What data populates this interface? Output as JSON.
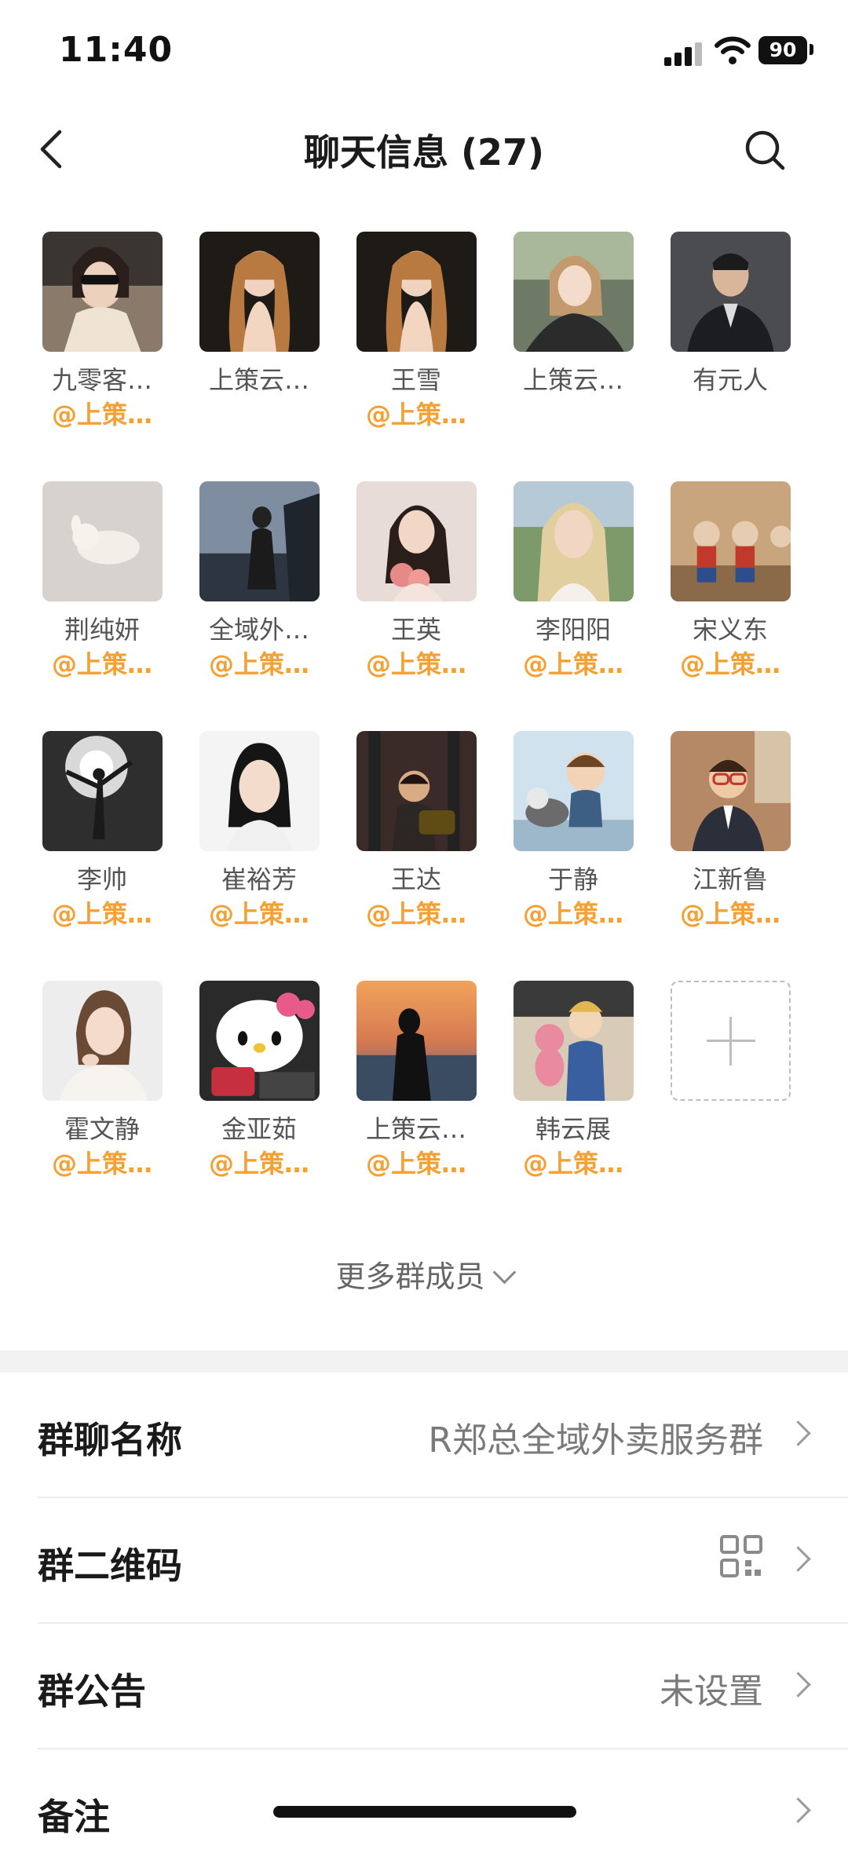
{
  "status_bar": {
    "time": "11:40",
    "battery": "90"
  },
  "header": {
    "title": "聊天信息 (27)"
  },
  "members": [
    {
      "name": "九零客…",
      "tag": "@上策…"
    },
    {
      "name": "上策云…",
      "tag": ""
    },
    {
      "name": "王雪",
      "tag": "@上策…"
    },
    {
      "name": "上策云…",
      "tag": ""
    },
    {
      "name": "有元人",
      "tag": ""
    },
    {
      "name": "荆纯妍",
      "tag": "@上策…"
    },
    {
      "name": "全域外…",
      "tag": "@上策…"
    },
    {
      "name": "王英",
      "tag": "@上策…"
    },
    {
      "name": "李阳阳",
      "tag": "@上策…"
    },
    {
      "name": "宋义东",
      "tag": "@上策…"
    },
    {
      "name": "李帅",
      "tag": "@上策…"
    },
    {
      "name": "崔裕芳",
      "tag": "@上策…"
    },
    {
      "name": "王达",
      "tag": "@上策…"
    },
    {
      "name": "于静",
      "tag": "@上策…"
    },
    {
      "name": "江新鲁",
      "tag": "@上策…"
    },
    {
      "name": "霍文静",
      "tag": "@上策…"
    },
    {
      "name": "金亚茹",
      "tag": "@上策…"
    },
    {
      "name": "上策云…",
      "tag": "@上策…"
    },
    {
      "name": "韩云展",
      "tag": "@上策…"
    }
  ],
  "more_members": "更多群成员",
  "settings": {
    "group_name": {
      "label": "群聊名称",
      "value": "R郑总全域外卖服务群"
    },
    "qr_code": {
      "label": "群二维码"
    },
    "announcement": {
      "label": "群公告",
      "value": "未设置"
    },
    "remark": {
      "label": "备注"
    }
  },
  "colors": {
    "accent_tag": "#f5a033",
    "text_secondary": "#7a7a7a"
  }
}
